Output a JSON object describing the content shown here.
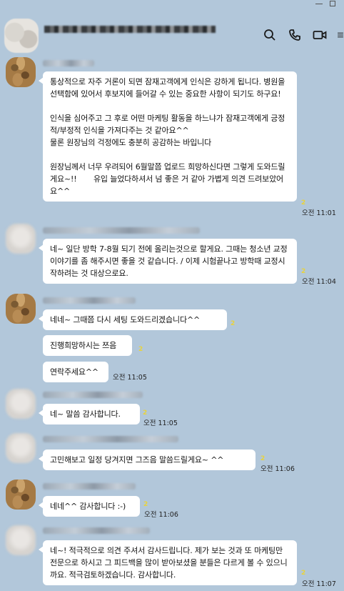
{
  "window": {
    "icons": [
      "search-icon",
      "phone-icon",
      "video-icon",
      "menu-icon"
    ]
  },
  "messages": [
    {
      "id": "m1",
      "bubbles": [
        "통상적으로 자주 거론이 되면 잠재고객에게 인식은 강하게 됩니다. 병원을 선택함에 있어서 후보지에 들어갈 수 있는 중요한 사항이 되기도 하구요!\n\n인식을 심어주고 그 후로 어떤 마케팅 활동을 하느냐가 잠재고객에게 긍정적/부정적 인식을 가져다주는 것 같아요^^\n물론 원장님의 걱정에도 충분히 공감하는 바입니다\n\n원장님께서 너무 우려되어 6월말쯤 업로드 희망하신다면 그렇게 도와드릴게요~!!       유입 늘었다하셔서 넘 좋은 거 같아 가볍게 의견 드려보았어요^^"
      ],
      "unread": "2",
      "time": "오전 11:01"
    },
    {
      "id": "m2",
      "bubbles": [
        "네~ 일단 방학 7-8월 되기 전에 올리는것으로 할게요. 그때는 청소년 교정이야기를 좀 해주시면 좋을 것 같습니다. / 이제 시험끝나고 방학때 교정시작하려는 것 대상으로요."
      ],
      "unread": "2",
      "time": "오전 11:04"
    },
    {
      "id": "m3",
      "bubbles": [
        "네네~ 그때쯤 다시 세팅 도와드리겠습니다^^",
        "진행희망하시는 쯔음",
        "연락주세요^^"
      ],
      "unread": [
        "2",
        "2",
        ""
      ],
      "time": "오전 11:05"
    },
    {
      "id": "m4",
      "bubbles": [
        "네~ 말씀 감사합니다."
      ],
      "unread": "2",
      "time": "오전 11:05"
    },
    {
      "id": "m5",
      "bubbles": [
        "고민해보고 일정 당겨지면 그즈음 말씀드릴게요~ ^^"
      ],
      "unread": "2",
      "time": "오전 11:06"
    },
    {
      "id": "m6",
      "bubbles": [
        "네네^^ 감사합니다 :-)"
      ],
      "unread": "2",
      "time": "오전 11:06"
    },
    {
      "id": "m7",
      "bubbles": [
        "네~! 적극적으로 의견 주셔서 감사드립니다. 제가 보는 것과 또 마케팅만 전문으로 하시고 그 피드백을 많이 받아보셨을 분들은 다르게 볼 수 있으니까요. 적극검토하겠습니다. 감사합니다."
      ],
      "unread": "2",
      "time": "오전 11:07"
    }
  ]
}
